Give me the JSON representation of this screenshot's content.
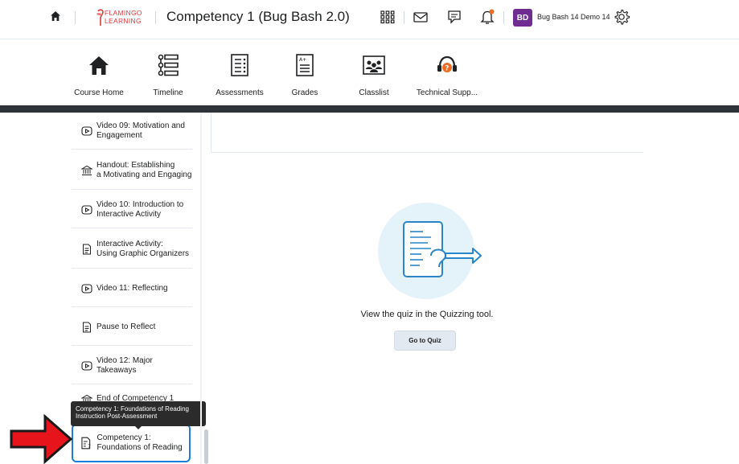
{
  "header": {
    "logo_line1": "FLAMINGO",
    "logo_line2": "LEARNING",
    "course_title": "Competency 1 (Bug Bash 2.0)",
    "avatar_initials": "BD",
    "username": "Bug Bash 14 Demo 14"
  },
  "navbar": {
    "items": [
      {
        "label": "Course Home",
        "icon": "home-icon"
      },
      {
        "label": "Timeline",
        "icon": "timeline-icon"
      },
      {
        "label": "Assessments",
        "icon": "assessments-icon"
      },
      {
        "label": "Grades",
        "icon": "grades-icon"
      },
      {
        "label": "Classlist",
        "icon": "classlist-icon"
      },
      {
        "label": "Technical Supp...",
        "icon": "support-icon"
      }
    ]
  },
  "sidebar": {
    "items": [
      {
        "label": "Video 09: Motivation and Engagement",
        "icon": "video-icon"
      },
      {
        "label": "Handout: Establishing a Motivating and Engaging",
        "icon": "handout-icon"
      },
      {
        "label": "Video 10: Introduction to Interactive Activity",
        "icon": "video-icon"
      },
      {
        "label": "Interactive Activity: Using Graphic Organizers",
        "icon": "document-icon"
      },
      {
        "label": "Video 11: Reflecting",
        "icon": "video-icon"
      },
      {
        "label": "Pause to Reflect",
        "icon": "document-icon"
      },
      {
        "label": "Video 12: Major Takeaways",
        "icon": "video-icon"
      },
      {
        "label": "End of Competency 1",
        "icon": "handout-icon"
      }
    ],
    "selected": {
      "label": "Competency 1: Foundations of Reading",
      "icon": "quiz-icon"
    },
    "tooltip": "Competency 1: Foundations of Reading Instruction Post-Assessment"
  },
  "main": {
    "message": "View the quiz in the Quizzing tool.",
    "button_label": "Go to Quiz"
  },
  "colors": {
    "accent": "#1e7bd6",
    "avatar": "#6f2c91",
    "nav_border": "#2e3239",
    "arrow_red": "#e8141b",
    "illustration_bg": "#e4f2f9",
    "illustration_stroke": "#2a86c9"
  }
}
